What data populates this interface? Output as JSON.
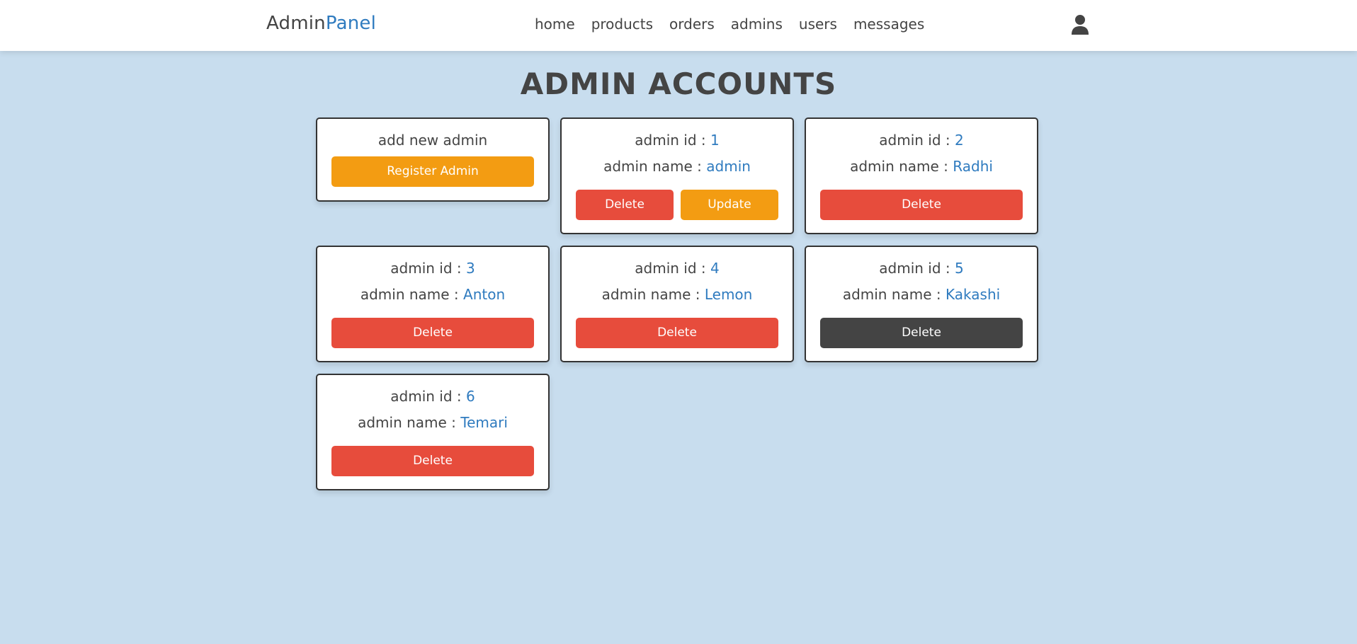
{
  "header": {
    "logo_main": "Admin",
    "logo_accent": "Panel",
    "nav": [
      "home",
      "products",
      "orders",
      "admins",
      "users",
      "messages"
    ],
    "user_icon": "user-icon"
  },
  "page": {
    "title": "ADMIN ACCOUNTS"
  },
  "register_card": {
    "label": "add new admin",
    "button": "Register Admin"
  },
  "labels": {
    "id": "admin id : ",
    "name": "admin name : ",
    "delete": "Delete",
    "update": "Update"
  },
  "admins": [
    {
      "id": "1",
      "name": "admin"
    },
    {
      "id": "2",
      "name": "Radhi"
    },
    {
      "id": "3",
      "name": "Anton"
    },
    {
      "id": "4",
      "name": "Lemon"
    },
    {
      "id": "5",
      "name": "Kakashi"
    },
    {
      "id": "6",
      "name": "Temari"
    }
  ],
  "colors": {
    "accent": "#2f7bbf",
    "delete": "#e74c3c",
    "update": "#f39c12",
    "delete_hover": "#444444",
    "background": "#c8ddee"
  }
}
